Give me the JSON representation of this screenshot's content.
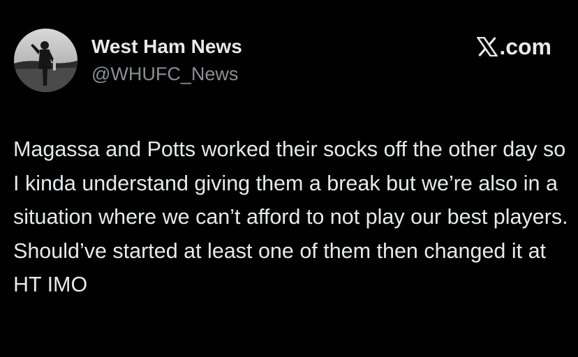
{
  "author": {
    "name": "West Ham News",
    "handle": "@WHUFC_News",
    "avatar_icon": "profile-photo"
  },
  "site": {
    "logo_icon": "x-logo-icon",
    "domain_suffix": ".com"
  },
  "tweet": {
    "text": "Magassa and Potts worked their socks off the other day so I kinda understand giving them a break but we’re also in a situation where we can’t afford to not play our best players. Should’ve started at least one of them then changed it at HT IMO"
  },
  "colors": {
    "background": "#000000",
    "primary_text": "#e7e9ea",
    "secondary_text": "#8b8f94"
  }
}
